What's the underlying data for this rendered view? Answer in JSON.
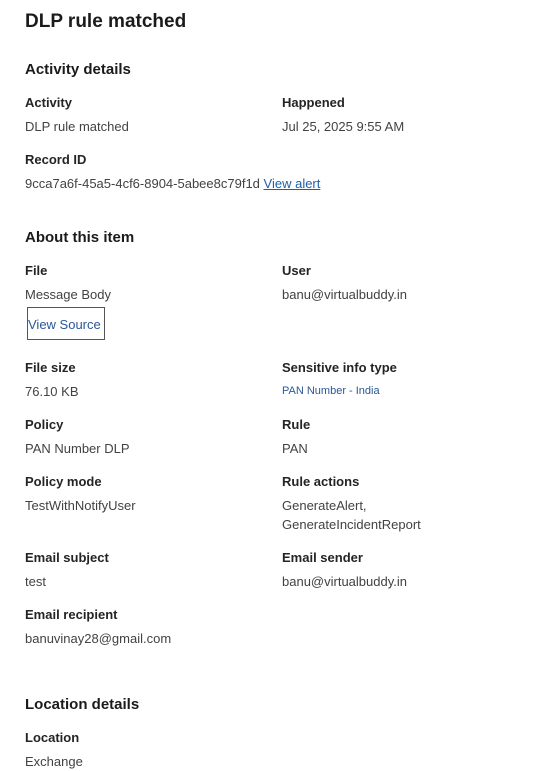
{
  "title": "DLP rule matched",
  "activity_details": {
    "heading": "Activity details",
    "activity_label": "Activity",
    "activity_value": "DLP rule matched",
    "happened_label": "Happened",
    "happened_value": "Jul 25, 2025 9:55 AM",
    "record_id_label": "Record ID",
    "record_id_value": "9cca7a6f-45a5-4cf6-8904-5abee8c79f1d",
    "view_alert_link": "View alert"
  },
  "about_item": {
    "heading": "About this item",
    "file_label": "File",
    "file_value": "Message Body",
    "view_source_button": "View Source",
    "user_label": "User",
    "user_value": "banu@virtualbuddy.in",
    "file_size_label": "File size",
    "file_size_value": "76.10 KB",
    "sit_label": "Sensitive info type",
    "sit_value": "PAN Number - India",
    "policy_label": "Policy",
    "policy_value": "PAN Number DLP",
    "rule_label": "Rule",
    "rule_value": "PAN",
    "policy_mode_label": "Policy mode",
    "policy_mode_value": "TestWithNotifyUser",
    "rule_actions_label": "Rule actions",
    "rule_actions_values": [
      "GenerateAlert,",
      "GenerateIncidentReport"
    ],
    "email_subject_label": "Email subject",
    "email_subject_value": "test",
    "email_sender_label": "Email sender",
    "email_sender_value": "banu@virtualbuddy.in",
    "email_recipient_label": "Email recipient",
    "email_recipient_value": "banuvinay28@gmail.com"
  },
  "location_details": {
    "heading": "Location details",
    "location_label": "Location",
    "location_value": "Exchange"
  }
}
